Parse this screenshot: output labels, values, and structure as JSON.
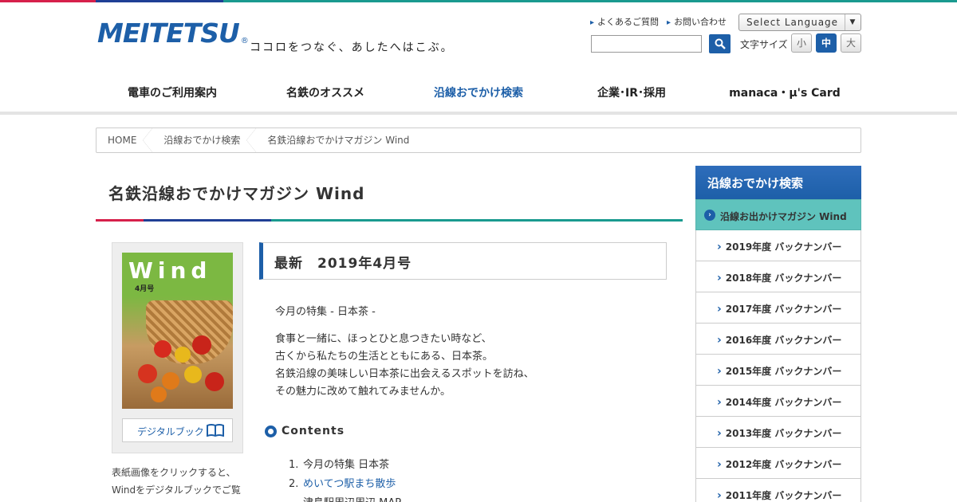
{
  "header": {
    "logo": "MEITETSU",
    "logo_mark": "®",
    "tagline": "ココロをつなぐ、あしたへはこぶ。",
    "util_links": [
      "よくあるご質問",
      "お問い合わせ"
    ],
    "language_select": "Select Language",
    "search_placeholder": "",
    "font_size_label": "文字サイズ",
    "font_sizes": [
      "小",
      "中",
      "大"
    ],
    "font_size_selected": "中"
  },
  "nav": {
    "items": [
      "電車のご利用案内",
      "名鉄のオススメ",
      "沿線おでかけ検索",
      "企業･IR･採用",
      "manaca・μ's Card"
    ],
    "active": "沿線おでかけ検索"
  },
  "breadcrumb": [
    "HOME",
    "沿線おでかけ検索",
    "名鉄沿線おでかけマガジン Wind"
  ],
  "page": {
    "title": "名鉄沿線おでかけマガジン Wind",
    "latest": "最新　2019年4月号",
    "cover_title": "Wind",
    "cover_issue": "4月号",
    "digital_book": "デジタルブック",
    "cover_note": "表紙画像をクリックすると、Windをデジタルブックでご覧いただけます。",
    "feature": "今月の特集 - 日本茶 -",
    "description": [
      "食事と一緒に、ほっとひと息つきたい時など、",
      "古くから私たちの生活とともにある、日本茶。",
      "名鉄沿線の美味しい日本茶に出会えるスポットを訪ね、",
      "その魅力に改めて触れてみませんか。"
    ],
    "contents_heading": "Contents",
    "contents": [
      {
        "num": "1.",
        "label": "今月の特集 日本茶"
      },
      {
        "num": "2.",
        "label": "めいてつ駅まち散歩",
        "sub": "津島駅周辺周辺 MAP"
      }
    ]
  },
  "sidebar": {
    "heading": "沿線おでかけ検索",
    "current": "沿線お出かけマガジン Wind",
    "items": [
      "2019年度 バックナンバー",
      "2018年度 バックナンバー",
      "2017年度 バックナンバー",
      "2016年度 バックナンバー",
      "2015年度 バックナンバー",
      "2014年度 バックナンバー",
      "2013年度 バックナンバー",
      "2012年度 バックナンバー",
      "2011年度 バックナンバー"
    ]
  },
  "colors": {
    "brand_blue": "#1d5fa8",
    "brand_teal": "#1a9a8f",
    "brand_red": "#d6204b"
  }
}
